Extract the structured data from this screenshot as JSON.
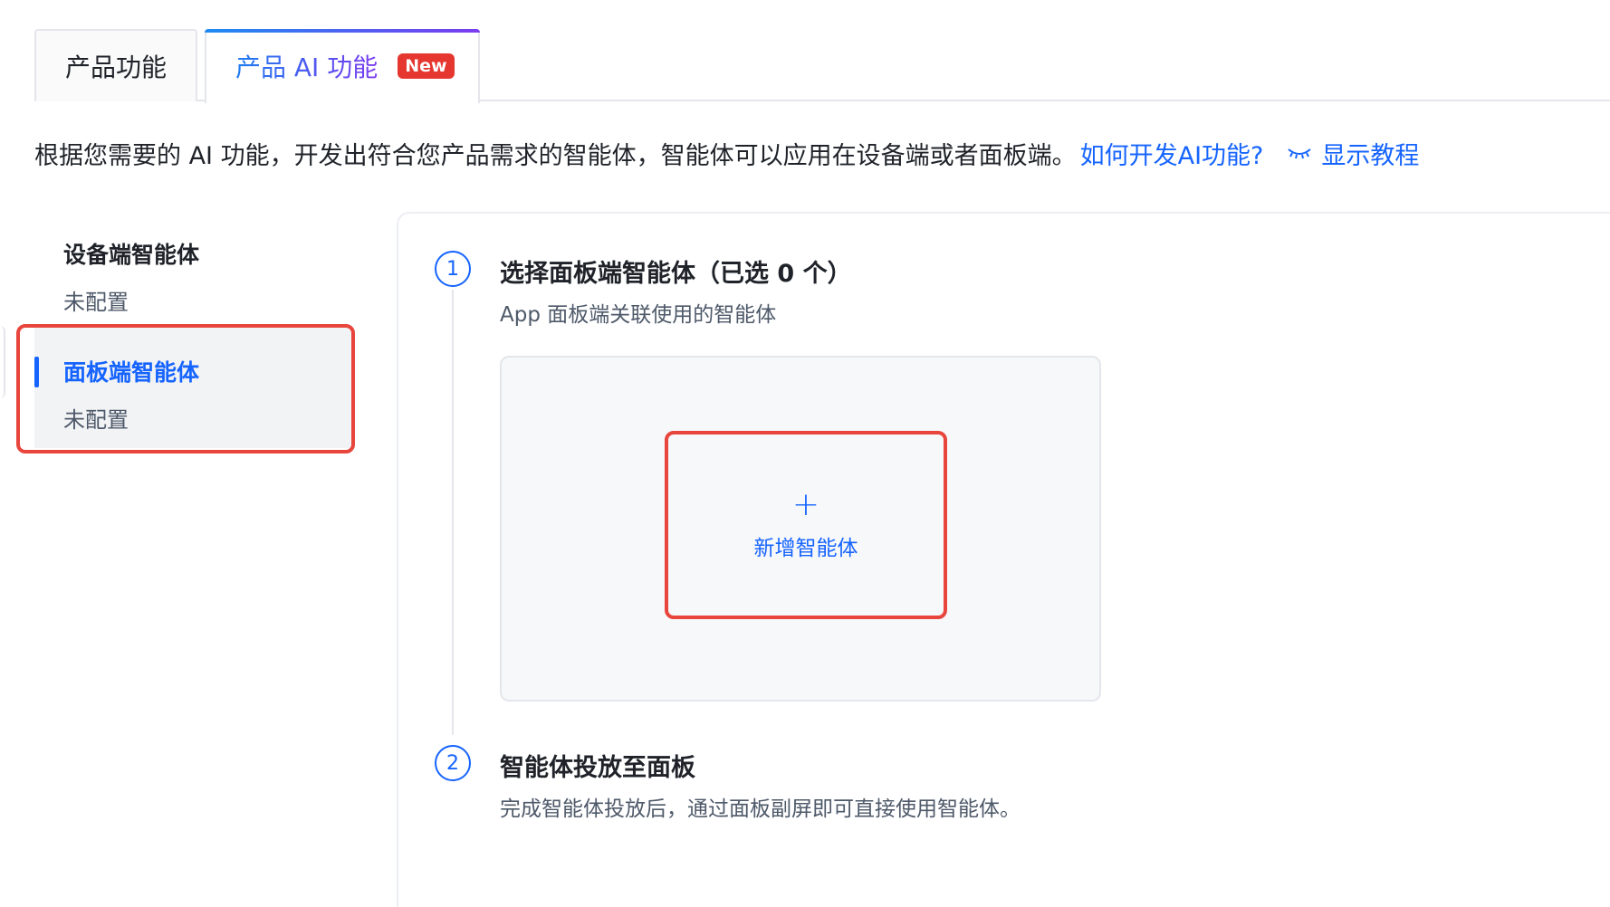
{
  "tabs": [
    {
      "label": "产品功能"
    },
    {
      "label": "产品 AI 功能",
      "badge": "New"
    }
  ],
  "description": {
    "text": "根据您需要的 AI 功能，开发出符合您产品需求的智能体，智能体可以应用在设备端或者面板端。",
    "link": "如何开发AI功能?",
    "tutorial": "显示教程"
  },
  "sidebar": {
    "items": [
      {
        "title": "设备端智能体",
        "status": "未配置"
      },
      {
        "title": "面板端智能体",
        "status": "未配置"
      }
    ]
  },
  "steps": [
    {
      "number": "1",
      "title": "选择面板端智能体（已选 0 个）",
      "desc": "App 面板端关联使用的智能体"
    },
    {
      "number": "2",
      "title": "智能体投放至面板",
      "desc": "完成智能体投放后，通过面板副屏即可直接使用智能体。"
    }
  ],
  "add_agent": {
    "icon": "+",
    "label": "新增智能体"
  },
  "colors": {
    "accent": "#1664ff",
    "highlight": "#e8453c",
    "badge": "#e5362f"
  }
}
